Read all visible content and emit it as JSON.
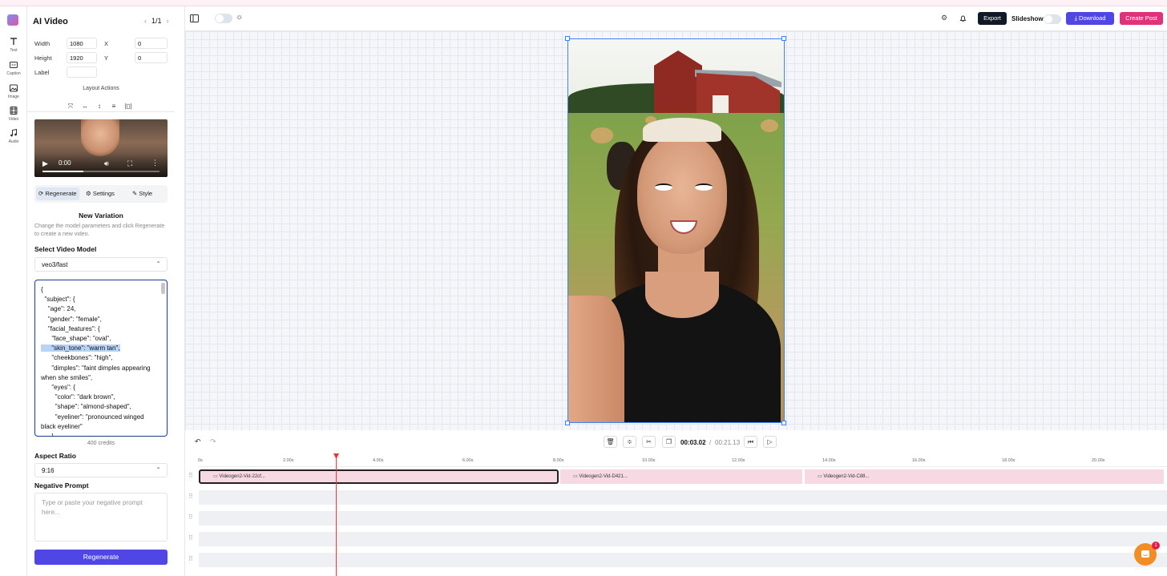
{
  "app": {
    "title": "AI Video",
    "page": "1/1"
  },
  "rail": [
    {
      "label": "Text",
      "icon": "text-icon"
    },
    {
      "label": "Caption",
      "icon": "caption-icon"
    },
    {
      "label": "Image",
      "icon": "image-icon"
    },
    {
      "label": "Video",
      "icon": "video-icon"
    },
    {
      "label": "Audio",
      "icon": "audio-icon"
    }
  ],
  "props": {
    "width_label": "Width",
    "width": "1080",
    "x_label": "X",
    "x": "0",
    "height_label": "Height",
    "height": "1920",
    "y_label": "Y",
    "y": "0",
    "label_label": "Label",
    "label": "",
    "layout_actions": "Layout Actions"
  },
  "player": {
    "time": "0:00",
    "progress": 0.35
  },
  "tabs": [
    "Regenerate",
    "Settings",
    "Style"
  ],
  "variation": {
    "title": "New Variation",
    "help": "Change the model parameters and click Regenerate to create a new video.",
    "model_label": "Select Video Model",
    "model": "veo3/fast",
    "prompt_before": "{\n  \"subject\": {\n    \"age\": 24,\n    \"gender\": \"female\",\n    \"facial_features\": {\n      \"face_shape\": \"oval\",\n",
    "prompt_highlight": "      \"skin_tone\": \"warm tan\",",
    "prompt_after": "\n      \"cheekbones\": \"high\",\n      \"dimples\": \"faint dimples appearing when she smiles\",\n      \"eyes\": {\n        \"color\": \"dark brown\",\n        \"shape\": \"almond-shaped\",\n        \"eyeliner\": \"pronounced winged black eyeliner\"\n      }",
    "credits": "400 credits",
    "aspect_label": "Aspect Ratio",
    "aspect": "9:16",
    "negative_label": "Negative Prompt",
    "negative_placeholder": "Type or paste your negative prompt here...",
    "regenerate": "Regenerate"
  },
  "topbar": {
    "export": "Export",
    "slideshow": "Slideshow",
    "download": "Download",
    "create_post": "Create Post"
  },
  "colors": {
    "primary": "#4f46e5",
    "pink": "#e0317a",
    "dark": "#111827",
    "playhead": "#ee3333"
  },
  "timeline": {
    "current": "00:03.02",
    "separator": "/",
    "total": "00:21.13",
    "ticks": [
      "0s",
      "2.00s",
      "4.00s",
      "6.00s",
      "8.00s",
      "10.00s",
      "12.00s",
      "14.00s",
      "16.00s",
      "18.00s",
      "20.00s"
    ],
    "clips": [
      "Videogen2-Vid-22cf...",
      "Videogen2-Vid-D421...",
      "Videogen2-Vid-C88..."
    ]
  },
  "chat": {
    "badge": "1"
  }
}
